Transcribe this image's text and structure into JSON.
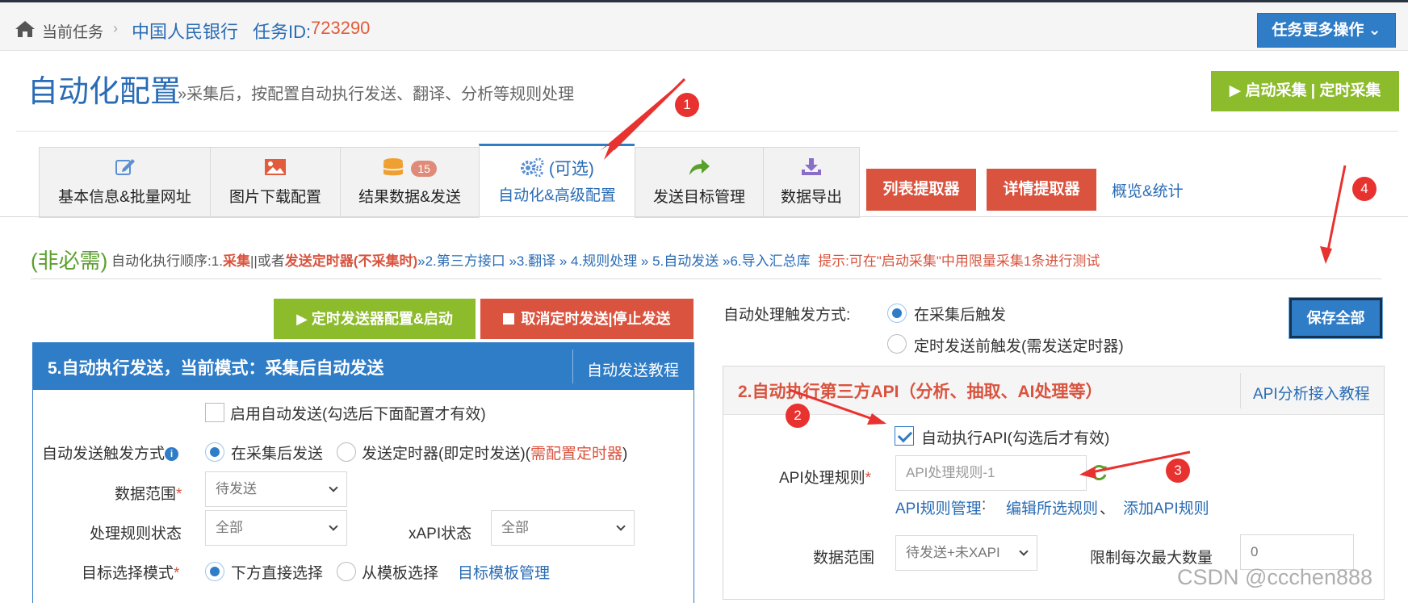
{
  "breadcrumb": {
    "current": "当前任务",
    "separator": "›",
    "task_name": "中国人民银行",
    "task_id_label": "任务ID:",
    "task_id": "723290"
  },
  "more_ops_label": "任务更多操作 ⌄",
  "header": {
    "title": "自动化配置",
    "subtitle": "»采集后，按配置自动执行发送、翻译、分析等规则处理",
    "start_button": "▶ 启动采集 | 定时采集"
  },
  "tabs": [
    {
      "label": "基本信息&批量网址",
      "icon": "edit-icon"
    },
    {
      "label": "图片下载配置",
      "icon": "image-icon"
    },
    {
      "label": "结果数据&发送",
      "icon": "database-icon",
      "badge": "15"
    },
    {
      "label": "自动化&高级配置",
      "icon": "gears-icon",
      "extra": "(可选)",
      "active": true
    },
    {
      "label": "发送目标管理",
      "icon": "share-icon"
    },
    {
      "label": "数据导出",
      "icon": "download-icon"
    }
  ],
  "extractors": {
    "list": "列表提取器",
    "detail": "详情提取器",
    "overview": "概览&统计"
  },
  "notice": {
    "optional": "(非必需)",
    "order_prefix": " 自动化执行顺序:1.",
    "collect": "采集",
    "or": "||或者",
    "timer": "发送定时器(不采集时)",
    "steps": "»2.第三方接口 »3.翻译 » 4.规则处理 » 5.自动发送 »6.导入汇总库",
    "tip": "提示:可在\"启动采集\"中用限量采集1条进行测试"
  },
  "left": {
    "timer_button": "▶ 定时发送器配置&启动",
    "cancel_button": "取消定时发送|停止发送",
    "panel_title": "5.自动执行发送，当前模式：采集后自动发送",
    "panel_link": "自动发送教程",
    "enable_label": "启用自动发送(勾选后下面配置才有效)",
    "trigger_label": "自动发送触发方式",
    "trigger_opt1": "在采集后发送",
    "trigger_opt2": "发送定时器(即定时发送)(",
    "trigger_opt2_link": "需配置定时器",
    "trigger_opt2_close": ")",
    "scope_label": "数据范围",
    "scope_value": "待发送",
    "rule_status_label": "处理规则状态",
    "rule_status_value": "全部",
    "xapi_label": "xAPI状态",
    "xapi_value": "全部",
    "target_mode_label": "目标选择模式",
    "target_opt1": "下方直接选择",
    "target_opt2": "从模板选择",
    "target_link": "目标模板管理",
    "asterisk": "*",
    "info": "i"
  },
  "right": {
    "trigger_label": "自动处理触发方式:",
    "trigger_opt1": "在采集后触发",
    "trigger_opt2": "定时发送前触发(需发送定时器)",
    "save_all": "保存全部",
    "panel_title": "2.自动执行第三方API（分析、抽取、AI处理等）",
    "panel_link": "API分析接入教程",
    "auto_api_label": "自动执行API(勾选后才有效)",
    "api_rule_label": "API处理规则",
    "api_rule_placeholder": "API处理规则-1",
    "api_rule_mgmt": "API规则管理",
    "colon": ":",
    "edit_rule": "编辑所选规则",
    "comma": "、",
    "add_rule": "添加API规则",
    "scope_label": "数据范围",
    "scope_value": "待发送+未XAPI",
    "limit_label": "限制每次最大数量",
    "limit_value": "0",
    "asterisk": "*"
  },
  "annotations": [
    "1",
    "2",
    "3",
    "4"
  ],
  "watermark": "CSDN @ccchen888",
  "colors": {
    "primary": "#2f7cc7",
    "link": "#2a6cb5",
    "danger": "#d9533e",
    "success": "#8cbb2c",
    "annotation": "#e8322f"
  }
}
